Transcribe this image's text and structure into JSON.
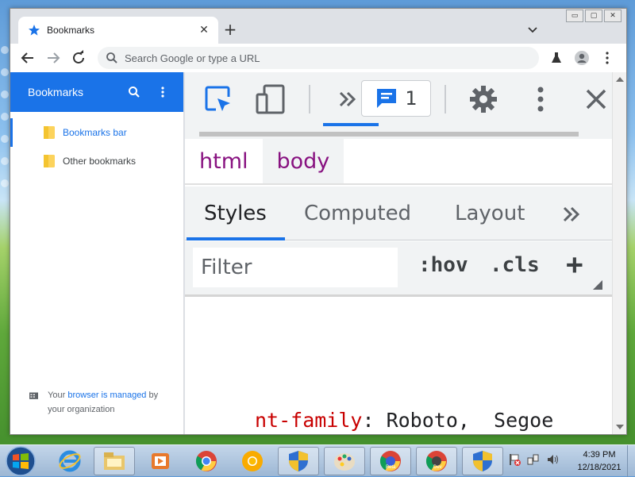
{
  "window": {
    "caption_buttons": [
      "▭",
      "▢",
      "✕"
    ]
  },
  "tab": {
    "title": "Bookmarks",
    "close_glyph": "✕",
    "new_tab_glyph": "+"
  },
  "omnibox": {
    "placeholder": "Search Google or type a URL"
  },
  "bookmarks": {
    "header_title": "Bookmarks",
    "items": [
      {
        "label": "Bookmarks bar",
        "selected": true
      },
      {
        "label": "Other bookmarks",
        "selected": false
      }
    ],
    "managed_prefix": "Your ",
    "managed_link": "browser is managed",
    "managed_suffix": " by your organization"
  },
  "devtools": {
    "issues_count": "1",
    "more_glyph": "»",
    "breadcrumbs": [
      "html",
      "body"
    ],
    "subtabs": [
      "Styles",
      "Computed",
      "Layout"
    ],
    "subtabs_more": "»",
    "filter_placeholder": "Filter",
    "hov_label": ":hov",
    "cls_label": ".cls",
    "add_label": "+",
    "code_prop": "nt-family",
    "code_rest": ": Roboto,  Segoe"
  },
  "taskbar": {
    "clock_time": "4:39 PM",
    "clock_date": "12/18/2021",
    "labels": {
      "beta": "Beta",
      "dev": "Dev"
    }
  },
  "colors": {
    "accent": "#1a73e8",
    "tag": "#881280",
    "css_prop": "#c80000"
  },
  "icons": [
    "star-icon",
    "back-icon",
    "forward-icon",
    "reload-icon",
    "search-icon",
    "lab-icon",
    "profile-icon",
    "menu-icon",
    "folder-icon",
    "building-icon",
    "inspect-icon",
    "device-toolbar-icon",
    "chevron-double-icon",
    "issues-icon",
    "settings-icon",
    "kebab-icon",
    "close-icon",
    "windows-start-icon",
    "ie-icon",
    "explorer-icon",
    "media-icon",
    "chrome-icon",
    "canary-icon",
    "shield-icon",
    "paint-icon"
  ]
}
